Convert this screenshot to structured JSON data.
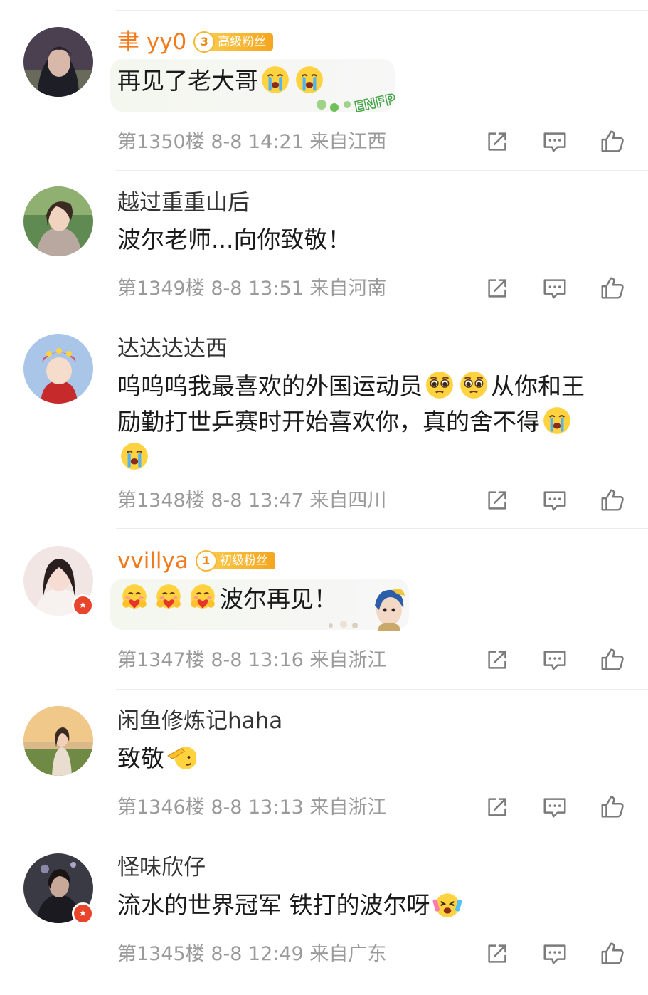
{
  "comments": [
    {
      "username": "聿 yy0",
      "fan_badge": {
        "level": "3",
        "label": "高级粉丝"
      },
      "text": "再见了老大哥",
      "emojis": [
        "crying-emoji",
        "crying-emoji"
      ],
      "bubble_decoration": "ENFP",
      "floor": "第1350楼",
      "date": "8-8 14:21",
      "location": "来自江西"
    },
    {
      "username": "越过重重山后",
      "text": "波尔老师...向你致敬！",
      "floor": "第1349楼",
      "date": "8-8 13:51",
      "location": "来自河南"
    },
    {
      "username": "达达达达西",
      "text_line1": "呜呜呜我最喜欢的外国运动员",
      "text_line1_tail": "从你和王",
      "text_line2": "励勤打世乒赛时开始喜欢你，真的舍不得",
      "emojis": [
        "pleading-emoji",
        "pleading-emoji",
        "crying-emoji",
        "crying-emoji"
      ],
      "floor": "第1348楼",
      "date": "8-8 13:47",
      "location": "来自四川"
    },
    {
      "username": "vvillya",
      "fan_badge": {
        "level": "1",
        "label": "初级粉丝"
      },
      "text": "波尔再见！",
      "emojis": [
        "hug-emoji",
        "hug-emoji",
        "hug-emoji"
      ],
      "floor": "第1347楼",
      "date": "8-8 13:16",
      "location": "来自浙江"
    },
    {
      "username": "闲鱼修炼记haha",
      "text": "致敬",
      "emojis": [
        "salute-emoji"
      ],
      "floor": "第1346楼",
      "date": "8-8 13:13",
      "location": "来自浙江"
    },
    {
      "username": "怪味欣仔",
      "text": "流水的世界冠军 铁打的波尔呀",
      "emojis": [
        "shocked-emoji"
      ],
      "floor": "第1345楼",
      "date": "8-8 12:49",
      "location": "来自广东"
    }
  ],
  "icons": {
    "share": "share-icon",
    "reply": "comment-icon",
    "like": "like-icon",
    "verified": "verified-badge-icon"
  },
  "colors": {
    "fan_name": "#f07a1c",
    "meta_text": "#9a9a9a",
    "verified_badge": "#e8452c",
    "fan_badge": "#f6a51f"
  }
}
